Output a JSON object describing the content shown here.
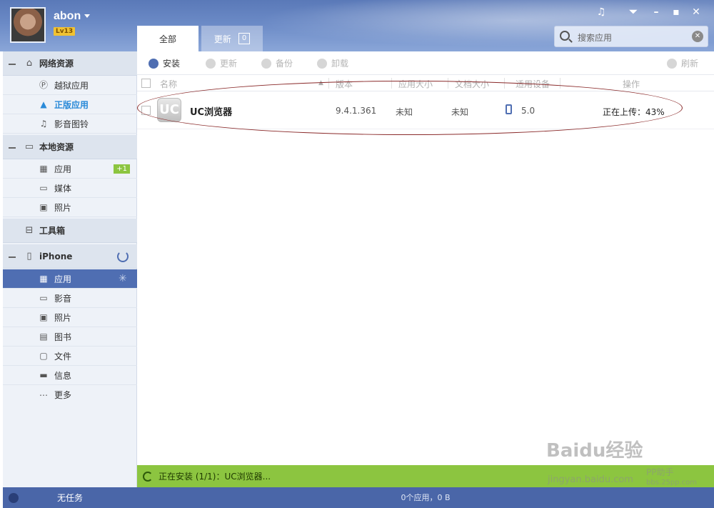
{
  "user": {
    "name": "abon",
    "level": "Lv13"
  },
  "tabs": [
    {
      "label": "全部"
    },
    {
      "label": "更新",
      "badge": "0"
    }
  ],
  "search": {
    "placeholder": "搜索应用"
  },
  "sidebar": {
    "online": {
      "label": "网络资源",
      "items": [
        {
          "label": "越狱应用"
        },
        {
          "label": "正版应用"
        },
        {
          "label": "影音图铃"
        }
      ]
    },
    "local": {
      "label": "本地资源",
      "items": [
        {
          "label": "应用",
          "badge": "+1"
        },
        {
          "label": "媒体"
        },
        {
          "label": "照片"
        }
      ]
    },
    "toolbox": {
      "label": "工具箱"
    },
    "device": {
      "label": "iPhone",
      "items": [
        {
          "label": "应用"
        },
        {
          "label": "影音"
        },
        {
          "label": "照片"
        },
        {
          "label": "图书"
        },
        {
          "label": "文件"
        },
        {
          "label": "信息"
        },
        {
          "label": "更多"
        }
      ]
    }
  },
  "toolbar": {
    "install": "安装",
    "update": "更新",
    "backup": "备份",
    "uninstall": "卸载",
    "refresh": "刷新"
  },
  "columns": {
    "name": "名称",
    "version": "版本",
    "app_size": "应用大小",
    "doc_size": "文档大小",
    "device": "适用设备",
    "action": "操作"
  },
  "apps": [
    {
      "name": "UC浏览器",
      "icon_letter": "UC",
      "version": "9.4.1.361",
      "app_size": "未知",
      "doc_size": "未知",
      "device": "5.0",
      "action": "正在上传：43%",
      "upload_progress": 0.43
    }
  ],
  "status": {
    "install_progress": "正在安装 (1/1)：UC浏览器...",
    "bottom_summary": "0个应用，0 B",
    "no_task": "无任务"
  },
  "watermark": {
    "baidu": "Baidu经验",
    "url": "jingyan.baidu.com",
    "site": "bbs.25pp.com",
    "brand": "PP助手"
  },
  "colors": {
    "accent": "#4f6eb2",
    "progress_green": "#8cc540",
    "header": "#6b8ac6"
  }
}
